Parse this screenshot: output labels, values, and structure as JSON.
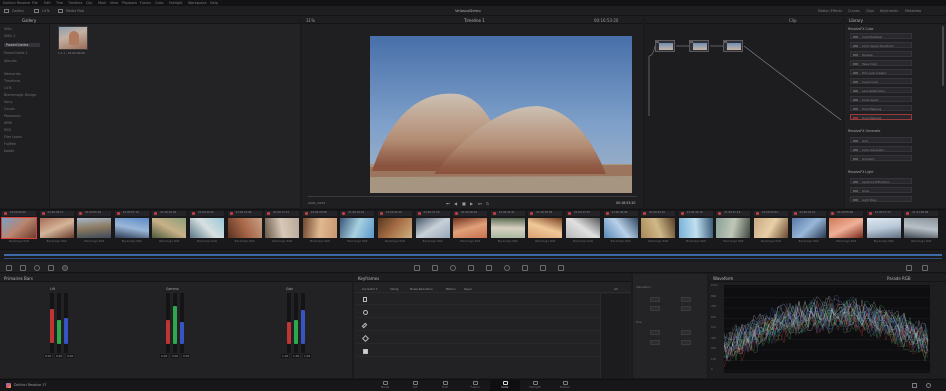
{
  "menubar": {
    "app_menu": "DaVinci Resolve",
    "items": [
      "File",
      "Edit",
      "Trim",
      "Timeline",
      "Clip",
      "Mark",
      "View",
      "Playback",
      "Fusion",
      "Color",
      "Fairlight",
      "Workspace",
      "Help"
    ]
  },
  "toolbar": {
    "project_title": "VeloscoDemo",
    "left_tabs": [
      "Gallery",
      "LUTs",
      "Media Pool"
    ],
    "right_tabs": [
      "Motion Effects",
      "Curves",
      "Clips",
      "Keyframes",
      "Metadata"
    ]
  },
  "gallery": {
    "title": "Gallery",
    "albums": [
      "Stills",
      "Stills 1",
      "PowerGrades",
      "PowerGrade 1",
      "Albums",
      "Memories",
      "Timelines",
      "LUTs",
      "Blackmagic Design",
      "Sony",
      "Canon",
      "Panasonic",
      "ARRI",
      "RED",
      "Film Looks",
      "Fujifilm",
      "Kodak"
    ],
    "still_label": "1.1.1 - 01:00:00:00"
  },
  "viewer": {
    "tab": "Timeline 1",
    "zoom": "31%",
    "timecode": "00:16:53:20",
    "clip_name": "A001_C032"
  },
  "nodes": {
    "title": "Clip",
    "labels": [
      "01",
      "02",
      "03"
    ]
  },
  "library": {
    "title": "Library",
    "sections": [
      {
        "name": "ResolveFX Color",
        "items": [
          "ColorStabilizer",
          "Color Space Transform",
          "Dehaze",
          "False Color",
          "Film Look Creator",
          "Invert Color",
          "Lens Reflections",
          "Luma Keyer",
          "Tone Mapping"
        ]
      },
      {
        "name": "ResolveFX Generate",
        "items": [
          "Grid",
          "Color Generator",
          "Gradient"
        ]
      },
      {
        "name": "ResolveFX Light",
        "items": [
          "Aperture Diffraction",
          "Glow",
          "Light Rays"
        ]
      }
    ]
  },
  "clips": {
    "labels": [
      "01:00:00:00",
      "01:00:02:17",
      "01:00:05:02",
      "01:00:07:19",
      "01:00:10:04",
      "01:00:12:21",
      "01:00:15:06",
      "01:00:17:23",
      "01:00:20:08",
      "01:00:23:01",
      "01:00:25:10",
      "01:00:27:19",
      "01:00:30:04",
      "01:00:32:21",
      "01:00:35:06",
      "01:00:37:23",
      "01:00:40:08",
      "01:00:43:01",
      "01:00:45:10",
      "01:00:47:19",
      "01:00:50:04",
      "01:00:52:21",
      "01:00:55:06",
      "01:00:57:23",
      "01:01:00:08"
    ],
    "codec": "Blackmagic RAW"
  },
  "color_wheels": {
    "title": "Primaries Bars",
    "groups": [
      {
        "name": "Lift",
        "values": [
          "0.00",
          "0.00",
          "0.00"
        ]
      },
      {
        "name": "Gamma",
        "values": [
          "0.00",
          "0.00",
          "0.00"
        ]
      },
      {
        "name": "Gain",
        "values": [
          "1.00",
          "1.00",
          "1.00"
        ]
      }
    ]
  },
  "keyframes": {
    "title": "Keyframes",
    "tabs": [
      "Corrector 1",
      "Sizing",
      "Noise Reduction",
      "Motion",
      "Keyer"
    ],
    "all": "All",
    "sub_left": "Saturation",
    "sub_left2": "Hue"
  },
  "scopes": {
    "title": "Waveform",
    "mode": "Parade RGB",
    "ticks": [
      "1023",
      "896",
      "768",
      "640",
      "512",
      "384",
      "256",
      "128",
      "0"
    ]
  },
  "pages": {
    "labels": [
      "Media",
      "Cut",
      "Edit",
      "Fusion",
      "Color",
      "Fairlight",
      "Deliver"
    ],
    "active": "Color"
  },
  "status": {
    "app": "DaVinci Resolve 17"
  },
  "colors": {
    "accent": "#d94040",
    "bg": "#1b1b1d",
    "panel": "#232326"
  }
}
